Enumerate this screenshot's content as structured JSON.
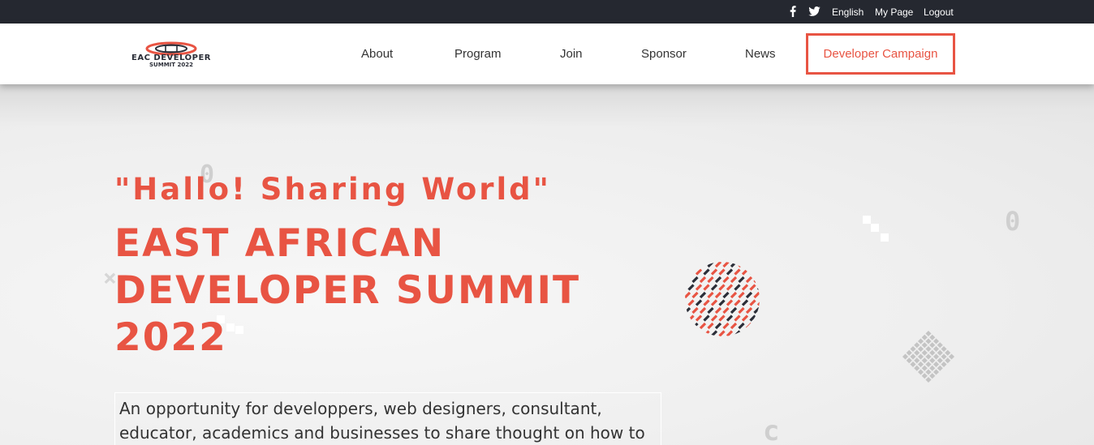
{
  "topbar": {
    "facebook_icon": "facebook-icon",
    "twitter_icon": "twitter-icon",
    "language": "English",
    "my_page": "My Page",
    "logout": "Logout"
  },
  "logo": {
    "line1": "EAC DEVELOPER",
    "line2": "SUMMIT 2022"
  },
  "nav": {
    "about": "About",
    "program": "Program",
    "join": "Join",
    "sponsor": "Sponsor",
    "news": "News",
    "developer_campaign": "Developer Campaign"
  },
  "hero": {
    "tagline": "\"Hallo! Sharing World\"",
    "title_lines": [
      "EAST AFRICAN",
      "DEVELOPER SUMMIT",
      "2022"
    ],
    "description": "An opportunity for developpers, web designers, consultant, educator, academics and businesses to share thought on how to"
  },
  "colors": {
    "accent": "#e85443",
    "topbar_bg": "#252830",
    "nav_text": "#333333",
    "hero_bg": "#f1f1f1",
    "pattern_dark": "#2b2e38"
  }
}
